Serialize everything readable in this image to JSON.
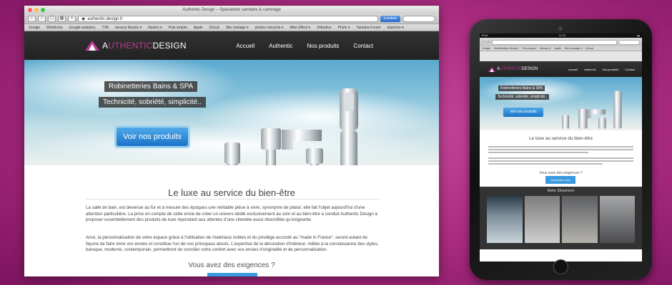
{
  "window": {
    "title": "Authentic Design – Spécialiste sanitaire & carrelage"
  },
  "toolbar": {
    "url": "authentic-design.fr",
    "reader_label": "Lecteur"
  },
  "bookmarks": [
    "Google",
    "Worldcom",
    "Google analytics",
    "TVA",
    "serveur illusion ▾",
    "Illusion ▾",
    "Pole emploi",
    "Apple",
    "iCloud",
    "Site mariage ▾",
    "photos retouche ▾",
    "After Effect ▾",
    "Videotive",
    "Photo ▾",
    "Yamaha Forum",
    "depeche ▾"
  ],
  "site": {
    "logo_first": "A",
    "logo_mid": "UTHENTIC",
    "logo_last": "DESIGN",
    "nav": [
      "Accueil",
      "Authentic",
      "Nos produits",
      "Contact"
    ],
    "hero_tag1": "Robinetteries Bains & SPA",
    "hero_tag2": "Technicité, sobriété, simplicité..",
    "hero_cta": "Voir nos produits",
    "heading": "Le luxe au service du bien-être",
    "para1": "La salle de bain, est devenue au fur et à mesure des époques une véritable pièce à vivre, synonyme de plaisir, elle fait l'objet aujourd'hui d'une attention particulière. La prise en compte de cette envie de créer un univers dédié exclusivement au soin et au bien-être a conduit Authentic Design à proposer essentiellement des produits de luxe répondant aux attentes d'une clientèle aussi diversifiée qu'exigeante.",
    "para2": "Ainsi, la personnalisation de votre espace grâce à l'utilisation de matériaux nobles et du privilège accordé au \"made in France\", seront autant de façons de faire vivre vos envies et constitue l'un de nos principaux atouts. L'expertise de la décoration d'intérieur, mêlée à la connaissance des styles, baroque, moderne, contemporain, permettront de concilier votre confort avec vos envies d'originalité et de personnalisation.",
    "subheading": "Vous avez des exigences ?"
  },
  "ipad": {
    "status_left": "iPad",
    "status_time": "11:22",
    "bookmarks": [
      "Google",
      "Modélisation Illusion",
      "Pole emploi",
      "Illusion ▾",
      "Apple",
      "Site mariage ▾",
      "iCloud"
    ],
    "nav": [
      "Accueil",
      "Authentic",
      "Nos produits",
      "Contact"
    ],
    "hero_tag1": "Robinetteries Bains & SPA",
    "hero_tag2": "Technicité, sobriété, simplicité..",
    "hero_cta": "Voir nos produits",
    "heading": "Le luxe au service du bien-être",
    "subheading": "Vous avez des exigences ?",
    "cta2": "Contactez nous",
    "showroom": "Notre Showroom"
  },
  "colors": {
    "accent": "#c03b94",
    "cta_blue": "#1b72c9",
    "background": "#a82a7f"
  }
}
